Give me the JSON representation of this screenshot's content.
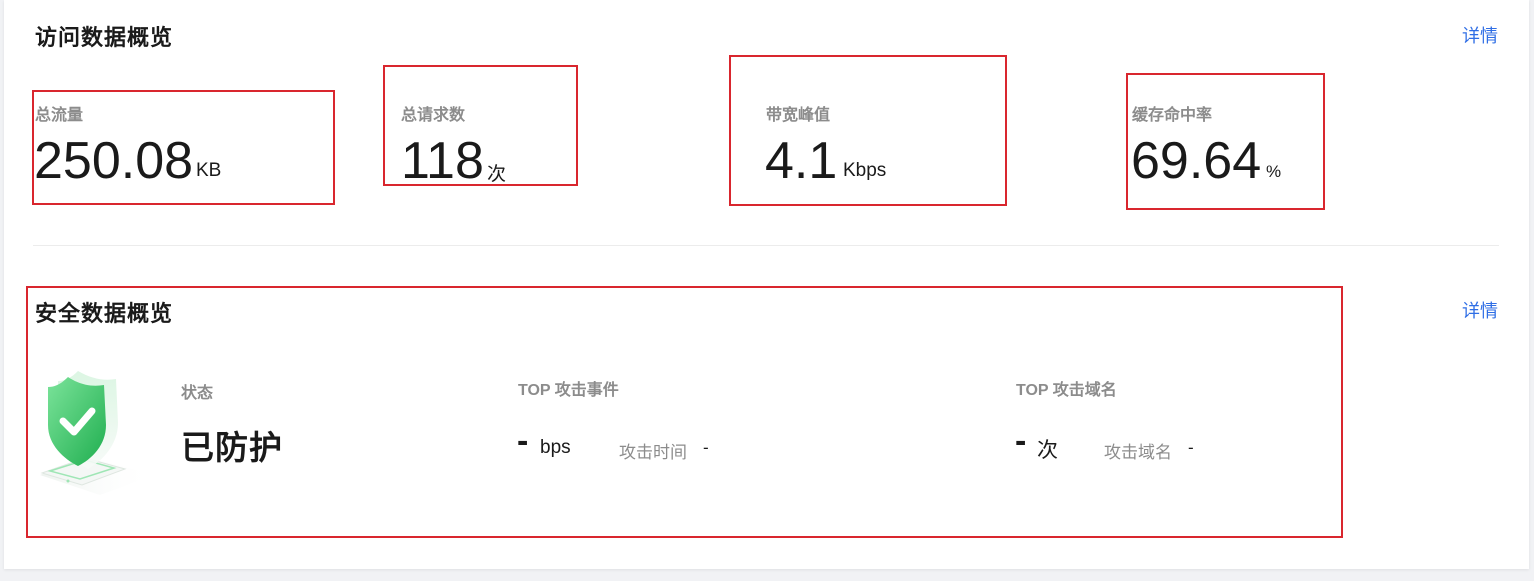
{
  "access_overview": {
    "title": "访问数据概览",
    "detail_label": "详情",
    "metrics": [
      {
        "label": "总流量",
        "value": "250.08",
        "unit": "KB"
      },
      {
        "label": "总请求数",
        "value": "118",
        "unit": "次"
      },
      {
        "label": "带宽峰值",
        "value": "4.1",
        "unit": "Kbps"
      },
      {
        "label": "缓存命中率",
        "value": "69.64",
        "unit": "%"
      }
    ]
  },
  "security_overview": {
    "title": "安全数据概览",
    "detail_label": "详情",
    "shield_icon": "shield-check-icon",
    "status": {
      "label": "状态",
      "value": "已防护"
    },
    "top_attack_event": {
      "label": "TOP 攻击事件",
      "value": "-",
      "unit": "bps",
      "time_label": "攻击时间",
      "time_value": "-"
    },
    "top_attack_domain": {
      "label": "TOP 攻击域名",
      "value": "-",
      "unit": "次",
      "domain_label": "攻击域名",
      "domain_value": "-"
    }
  },
  "colors": {
    "accent_link": "#2f6ee5",
    "highlight_border": "#d9262e",
    "shield_green": "#3cc46a"
  }
}
